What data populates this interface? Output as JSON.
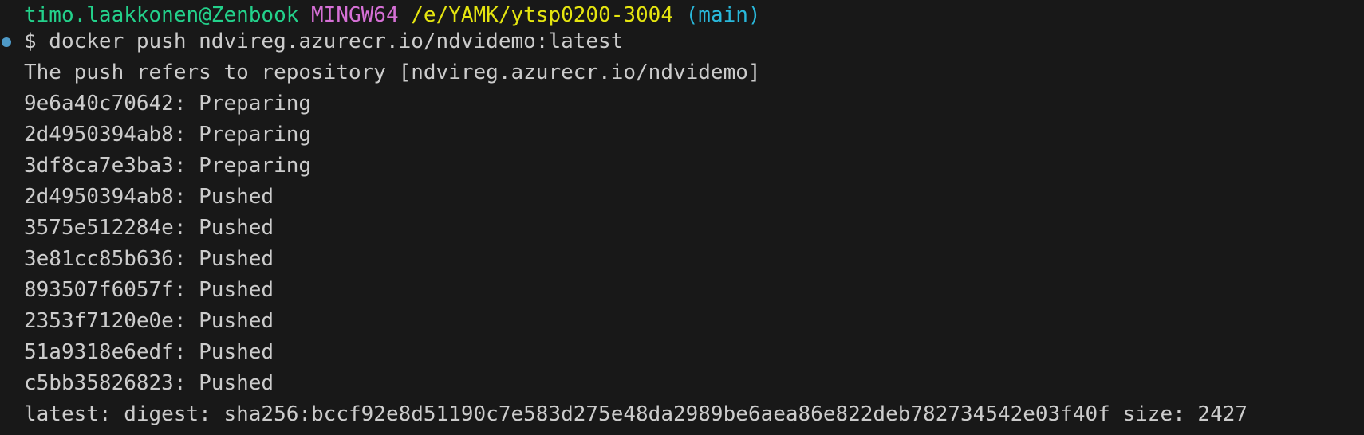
{
  "prompt": {
    "user_host": "timo.laakkonen@Zenbook",
    "system": "MINGW64",
    "path": "/e/YAMK/ytsp0200-3004",
    "branch": "(main)"
  },
  "command": "$ docker push ndvireg.azurecr.io/ndvidemo:latest",
  "output": [
    "The push refers to repository [ndvireg.azurecr.io/ndvidemo]",
    "9e6a40c70642: Preparing",
    "2d4950394ab8: Preparing",
    "3df8ca7e3ba3: Preparing",
    "2d4950394ab8: Pushed",
    "3575e512284e: Pushed",
    "3e81cc85b636: Pushed",
    "893507f6057f: Pushed",
    "2353f7120e0e: Pushed",
    "51a9318e6edf: Pushed",
    "c5bb35826823: Pushed",
    "latest: digest: sha256:bccf92e8d51190c7e583d275e48da2989be6aea86e822deb782734542e03f40f size: 2427"
  ],
  "colors": {
    "background": "#181818",
    "text": "#cccccc",
    "user_host": "#23d18b",
    "system": "#d670d6",
    "path": "#e5e510",
    "branch": "#29b8db",
    "decoration": "#4e9ac8"
  },
  "icons": {
    "command_decoration": "circle-icon"
  }
}
